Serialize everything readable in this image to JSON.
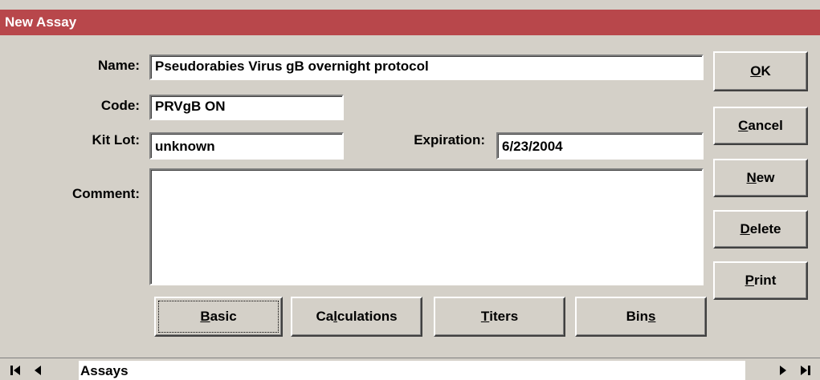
{
  "window": {
    "title": "New Assay"
  },
  "form": {
    "name_label": "Name:",
    "name_value": "Pseudorabies Virus gB overnight protocol",
    "code_label": "Code:",
    "code_value": "PRVgB ON",
    "kitlot_label": "Kit Lot:",
    "kitlot_value": "unknown",
    "expiration_label": "Expiration:",
    "expiration_value": "6/23/2004",
    "comment_label": "Comment:",
    "comment_value": ""
  },
  "side_buttons": {
    "ok": {
      "prefix": "",
      "mnemonic": "O",
      "suffix": "K"
    },
    "cancel": {
      "prefix": "",
      "mnemonic": "C",
      "suffix": "ancel"
    },
    "new": {
      "prefix": "",
      "mnemonic": "N",
      "suffix": "ew"
    },
    "delete": {
      "prefix": "",
      "mnemonic": "D",
      "suffix": "elete"
    },
    "print": {
      "prefix": "",
      "mnemonic": "P",
      "suffix": "rint"
    }
  },
  "tab_buttons": {
    "basic": {
      "prefix": "",
      "mnemonic": "B",
      "suffix": "asic"
    },
    "calculations": {
      "prefix": "Ca",
      "mnemonic": "l",
      "suffix": "culations"
    },
    "titers": {
      "prefix": "",
      "mnemonic": "T",
      "suffix": "iters"
    },
    "bins": {
      "prefix": "Bin",
      "mnemonic": "s",
      "suffix": ""
    }
  },
  "navigation": {
    "record_label": "Assays",
    "icons": [
      "first-record-icon",
      "previous-record-icon",
      "next-record-icon",
      "last-record-icon"
    ]
  },
  "colors": {
    "titlebar": "#b8474b",
    "face": "#d4d0c8"
  }
}
